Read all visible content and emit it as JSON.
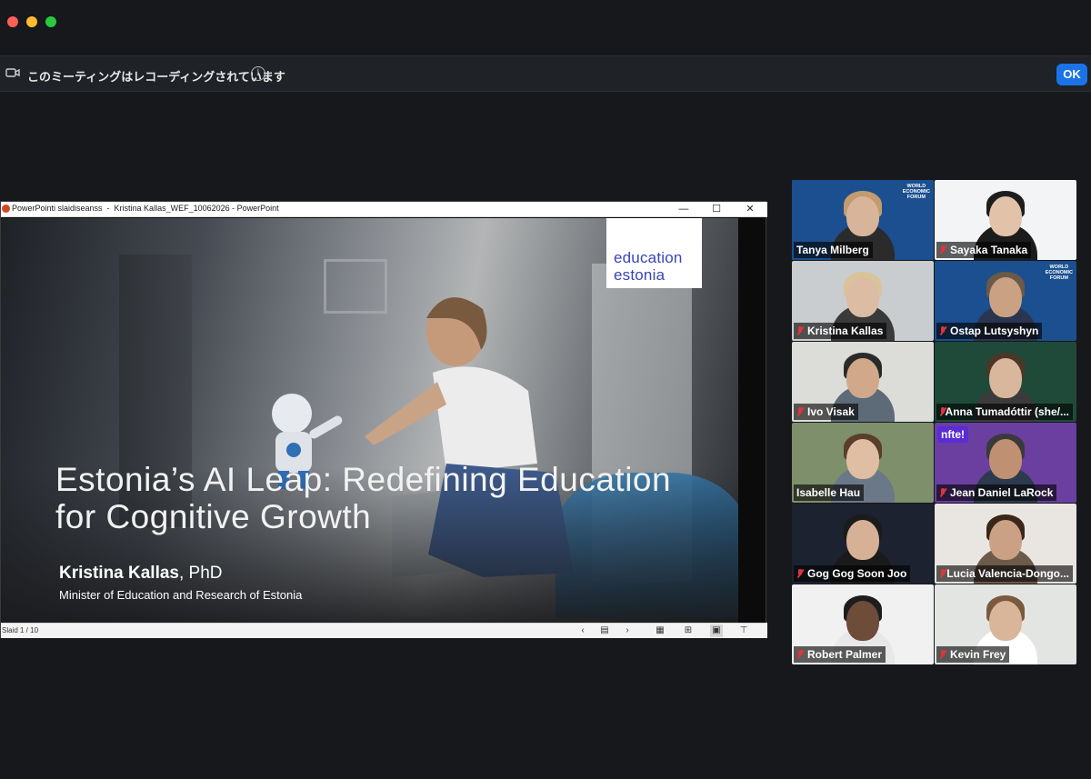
{
  "window": {
    "traffic_lights": [
      {
        "name": "close",
        "color": "#ff5f57"
      },
      {
        "name": "minimize",
        "color": "#febc2e"
      },
      {
        "name": "zoom",
        "color": "#28c840"
      }
    ]
  },
  "banner": {
    "icon": "video-camera-icon",
    "message": "このミーティングはレコーディングされています",
    "info_icon_glyph": "i",
    "ok_label": "OK"
  },
  "share": {
    "ppt_window_title": "PowerPointi slaidiseanss  -  Kristina Kallas_WEF_10062026 - PowerPoint",
    "window_buttons": {
      "minimize": "—",
      "maximize": "☐",
      "close": "✕"
    },
    "slide": {
      "logo_line1": "education",
      "logo_line2": "estonia",
      "title_line1": "Estonia’s AI Leap: Redefining Education",
      "title_line2": "for Cognitive Growth",
      "presenter_name": "Kristina Kallas",
      "presenter_suffix": ", PhD",
      "presenter_role": "Minister of Education and Research of Estonia"
    },
    "status": {
      "slide_counter": "Slaid 1 / 10",
      "controls": [
        "‹",
        "▤",
        "›",
        "▦",
        "⊞",
        "▣",
        "⊤"
      ]
    }
  },
  "gallery": {
    "participants": [
      {
        "name": "Tanya Milberg",
        "muted": false,
        "active_speaker": true,
        "bg": "#1b4f8f",
        "wef": true
      },
      {
        "name": "Sayaka Tanaka",
        "muted": true,
        "active_speaker": false,
        "bg": "#f2f4f6",
        "wef": false
      },
      {
        "name": "Kristina Kallas",
        "muted": true,
        "active_speaker": false,
        "bg": "#c9cdd0",
        "wef": false
      },
      {
        "name": "Ostap Lutsyshyn",
        "muted": true,
        "active_speaker": false,
        "bg": "#1b4f8f",
        "wef": true
      },
      {
        "name": "Ivo Visak",
        "muted": true,
        "active_speaker": false,
        "bg": "#dcdcd8",
        "wef": false
      },
      {
        "name": "Anna Tumadóttir (she/...",
        "muted": true,
        "active_speaker": false,
        "bg": "#1f4a3a",
        "wef": false
      },
      {
        "name": "Isabelle Hau",
        "muted": false,
        "active_speaker": false,
        "bg": "#7e8f6b",
        "wef": false
      },
      {
        "name": "Jean Daniel LaRock",
        "muted": true,
        "active_speaker": false,
        "bg": "#6a3fa0",
        "wef": false,
        "brand": "nfte!"
      },
      {
        "name": "Gog Gog Soon Joo",
        "muted": true,
        "active_speaker": false,
        "bg": "#1c2230",
        "wef": false
      },
      {
        "name": "Lucia Valencia-Dongo...",
        "muted": true,
        "active_speaker": false,
        "bg": "#e9e6e2",
        "wef": false
      },
      {
        "name": "Robert Palmer",
        "muted": true,
        "active_speaker": false,
        "bg": "#f1f1f1",
        "wef": false
      },
      {
        "name": "Kevin Frey",
        "muted": true,
        "active_speaker": false,
        "bg": "#e3e5e3",
        "wef": false
      }
    ],
    "wef_logo_text": "WORLD\nECONOMIC\nFORUM"
  },
  "colors": {
    "background": "#16181b",
    "active_speaker": "#35c33d",
    "muted_mic": "#e0343d",
    "ok_button": "#1a73e8",
    "logo_blue": "#3845b5"
  }
}
